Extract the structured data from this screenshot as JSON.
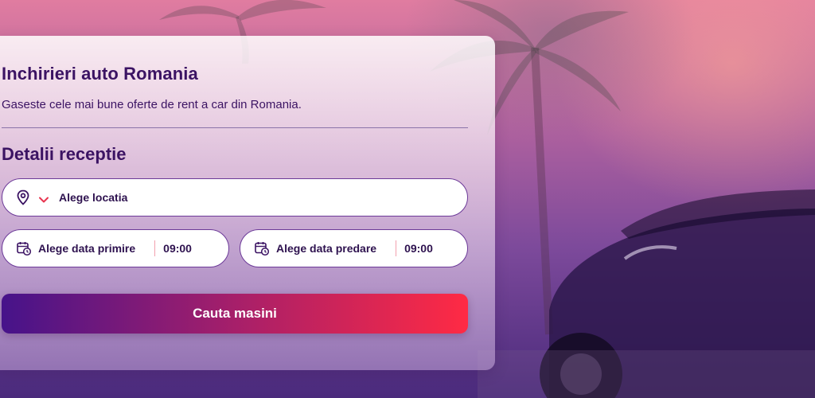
{
  "hero": {
    "title": "Inchirieri auto Romania",
    "subtitle": "Gaseste cele mai bune oferte de rent a car din Romania."
  },
  "pickup_details": {
    "heading": "Detalii receptie",
    "location": {
      "label": "Alege locatia",
      "icon": "map-pin-icon",
      "dropdown_icon": "chevron-down-icon"
    },
    "pickup_date": {
      "label": "Alege data primire",
      "time": "09:00",
      "icon": "calendar-clock-icon"
    },
    "dropoff_date": {
      "label": "Alege data predare",
      "time": "09:00",
      "icon": "calendar-clock-icon"
    }
  },
  "search_button": {
    "label": "Cauta masini"
  },
  "colors": {
    "heading_text": "#3b1363",
    "field_border": "#6c3a98",
    "button_gradient_start": "#46138a",
    "button_gradient_end": "#ff2a44",
    "chevron_accent": "#e8344f"
  }
}
